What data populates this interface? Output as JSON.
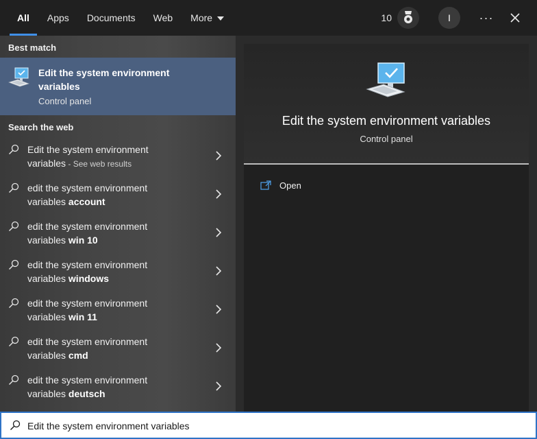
{
  "tabs": [
    {
      "label": "All",
      "active": true
    },
    {
      "label": "Apps",
      "active": false
    },
    {
      "label": "Documents",
      "active": false
    },
    {
      "label": "Web",
      "active": false
    },
    {
      "label": "More",
      "active": false
    }
  ],
  "header": {
    "points": "10",
    "reward_icon": "medal-icon",
    "avatar_initial": "I",
    "more_options": "···",
    "close_icon": "close-icon"
  },
  "best_match": {
    "section_label": "Best match",
    "title": "Edit the system environment variables",
    "subtitle": "Control panel",
    "icon": "computer-settings-icon"
  },
  "web": {
    "section_label": "Search the web",
    "items": [
      {
        "prefix": "Edit the system environment",
        "line2_plain": "variables",
        "bold": "",
        "suffix": " - See web results"
      },
      {
        "prefix": "edit the system environment",
        "line2_plain": "variables ",
        "bold": "account",
        "suffix": ""
      },
      {
        "prefix": "edit the system environment",
        "line2_plain": "variables ",
        "bold": "win 10",
        "suffix": ""
      },
      {
        "prefix": "edit the system environment",
        "line2_plain": "variables ",
        "bold": "windows",
        "suffix": ""
      },
      {
        "prefix": "edit the system environment",
        "line2_plain": "variables ",
        "bold": "win 11",
        "suffix": ""
      },
      {
        "prefix": "edit the system environment",
        "line2_plain": "variables ",
        "bold": "cmd",
        "suffix": ""
      },
      {
        "prefix": "edit the system environment",
        "line2_plain": "variables ",
        "bold": "deutsch",
        "suffix": ""
      }
    ]
  },
  "detail": {
    "title": "Edit the system environment variables",
    "subtitle": "Control panel",
    "open_label": "Open"
  },
  "search": {
    "value": "Edit the system environment variables"
  },
  "colors": {
    "accent": "#3f8fe8",
    "selected_bg": "#4b6080",
    "search_border": "#2f73c6"
  }
}
